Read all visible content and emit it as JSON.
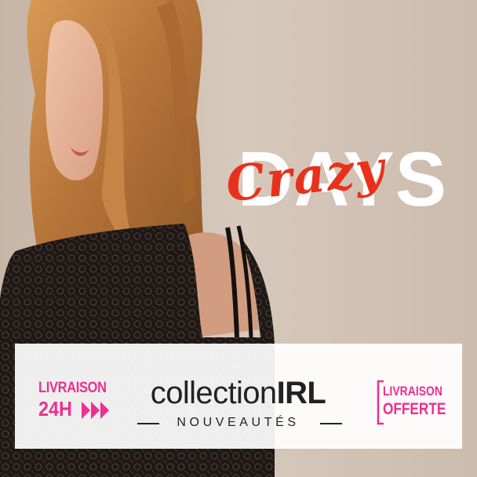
{
  "headline": {
    "days": "DAYS",
    "crazy": "Crazy",
    "days_color": "#ffffff",
    "crazy_color": "#e8311c"
  },
  "banner": {
    "delivery_24h": {
      "line1": "LIVRAISON",
      "line2": "24H",
      "icon": "triple-chevron-arrows-icon",
      "color": "#ee2f8e"
    },
    "brand": {
      "name_light": "collection",
      "name_bold": "IRL",
      "tagline": "NOUVEAUTÉS"
    },
    "free_delivery": {
      "line1": "LIVRAISON",
      "line2": "OFFERTE",
      "icon": "bracket-icon",
      "color": "#ee2f8e"
    }
  }
}
